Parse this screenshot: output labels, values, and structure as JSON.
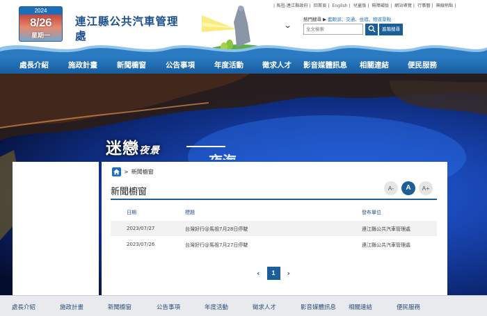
{
  "header": {
    "date": {
      "year": "2024",
      "month_day": "8/26",
      "weekday": "星期一"
    },
    "site_title": "連江縣公共汽車管理處",
    "top_links": [
      "馬祖-連江縣政府",
      "回首頁",
      "English",
      "兒童版",
      "無障礙版",
      "網站導覽",
      "行事曆",
      "無線熱點"
    ],
    "hot_search": {
      "label": "熱門搜尋 ▶",
      "items": [
        "藍眼淚",
        "交通",
        "住宿",
        "物遊景點"
      ]
    },
    "search": {
      "placeholder": "全文檢索",
      "advanced_label": "進階搜尋"
    }
  },
  "nav": {
    "items": [
      "處長介紹",
      "施政計畫",
      "新聞櫥窗",
      "公告事項",
      "年度活動",
      "徵求人才",
      "影音媒體訊息",
      "相關連結",
      "便民服務"
    ]
  },
  "banner": {
    "title": "迷戀",
    "title_small": "夜景",
    "partial_text": "夜海"
  },
  "content": {
    "breadcrumb": "新聞櫥窗",
    "page_title": "新聞櫥窗",
    "font_sizes": [
      "A-",
      "A",
      "A+"
    ],
    "table": {
      "headers": [
        "日期",
        "標題",
        "發布單位"
      ],
      "rows": [
        {
          "date": "2023/07/27",
          "title": "台灣好行@馬祖7月28日停駛",
          "unit": "連江縣公共汽車管理處"
        },
        {
          "date": "2023/07/26",
          "title": "台灣好行@馬祖7月27日停駛",
          "unit": "連江縣公共汽車管理處"
        }
      ]
    },
    "pager": {
      "prev": "‹",
      "current": "1",
      "next": "›"
    }
  },
  "footer": {
    "items": [
      "處長介紹",
      "施政計畫",
      "新聞櫥窗",
      "公告事項",
      "年度活動",
      "徵求人才",
      "影音媒體訊息",
      "相關連結",
      "便民服務"
    ]
  },
  "colors": {
    "primary": "#1b5f9a",
    "nav": "#2b7bc2",
    "title": "#1b4f8c"
  }
}
